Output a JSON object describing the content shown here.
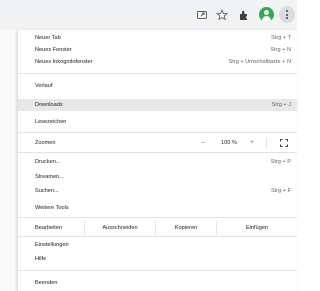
{
  "toolbar": {
    "icons": [
      "share-icon",
      "star-icon",
      "extensions-icon",
      "profile-avatar-icon",
      "menu-kebab-icon"
    ]
  },
  "menu": {
    "new_tab": {
      "label": "Neuer Tab",
      "shortcut": "Strg + T"
    },
    "new_window": {
      "label": "Neues Fenster",
      "shortcut": "Strg + N"
    },
    "new_incognito": {
      "label": "Neues Inkognitofenster",
      "shortcut": "Strg + Umschalttaste + N"
    },
    "history": {
      "label": "Verlauf"
    },
    "downloads": {
      "label": "Downloads",
      "shortcut": "Strg + J"
    },
    "bookmarks": {
      "label": "Lesezeichen"
    },
    "zoom": {
      "label": "Zoomen",
      "minus": "–",
      "value": "100 %",
      "plus": "+"
    },
    "print": {
      "label": "Drucken...",
      "shortcut": "Strg + P"
    },
    "cast": {
      "label": "Streamen..."
    },
    "find": {
      "label": "Suchen...",
      "shortcut": "Strg + F"
    },
    "more_tools": {
      "label": "Weitere Tools"
    },
    "edit": {
      "label": "Bearbeiten",
      "cut": "Ausschneiden",
      "copy": "Kopieren",
      "paste": "Einfügen"
    },
    "settings": {
      "label": "Einstellungen"
    },
    "help": {
      "label": "Hilfe"
    },
    "exit": {
      "label": "Beenden"
    }
  },
  "colors": {
    "highlight": "#e8e8e8",
    "avatar": "#34a853",
    "toolbar": "#f1f3f4"
  }
}
